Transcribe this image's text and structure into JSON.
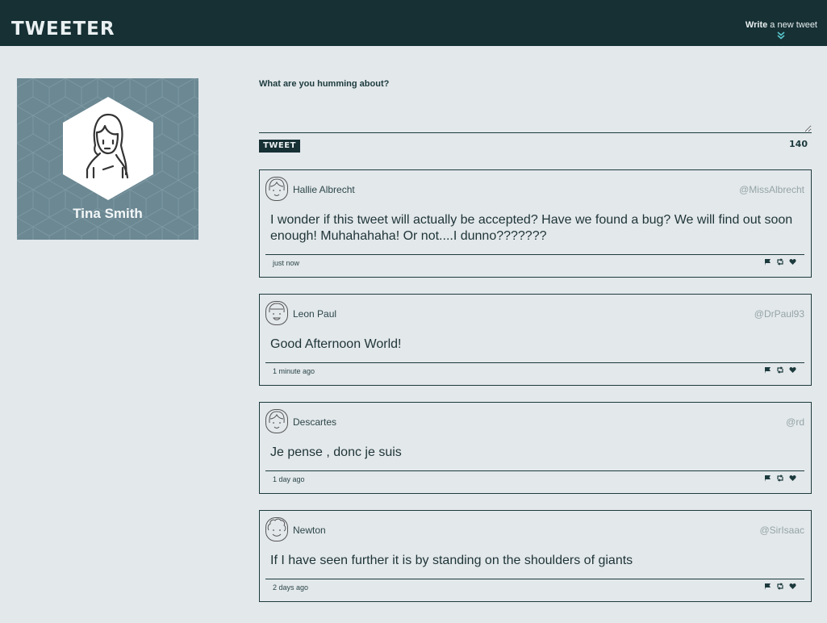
{
  "nav": {
    "brand": "TWEETER",
    "compose_bold": "Write",
    "compose_rest": " a new tweet",
    "compose_icon": "double-chevron-down-icon"
  },
  "profile": {
    "name": "Tina Smith",
    "avatar_icon": "woman-avatar-icon"
  },
  "composer": {
    "prompt": "What are you humming about?",
    "text_value": "",
    "button_label": "TWEET",
    "counter": "140"
  },
  "colors": {
    "nav_bg": "#163034",
    "page_bg": "#e3e8eb",
    "profile_bg": "#6b8893",
    "accent": "#58c7cc"
  },
  "tweets": [
    {
      "name": "Hallie Albrecht",
      "handle": "@MissAlbrecht",
      "text": "I wonder if this tweet will actually be accepted? Have we found a bug? We will find out soon enough! Muhahahaha! Or not....I dunno???????",
      "time": "just now",
      "avatar_icon": "girl-avatar-icon"
    },
    {
      "name": "Leon Paul",
      "handle": "@DrPaul93",
      "text": "Good Afternoon World!",
      "time": "1 minute ago",
      "avatar_icon": "boy-avatar-icon"
    },
    {
      "name": "Descartes",
      "handle": "@rd",
      "text": "Je pense , donc je suis",
      "time": "1 day ago",
      "avatar_icon": "girl-avatar-icon"
    },
    {
      "name": "Newton",
      "handle": "@SirIsaac",
      "text": "If I have seen further it is by standing on the shoulders of giants",
      "time": "2 days ago",
      "avatar_icon": "curly-hair-avatar-icon"
    }
  ],
  "action_icons": [
    "flag-icon",
    "retweet-icon",
    "heart-icon"
  ]
}
